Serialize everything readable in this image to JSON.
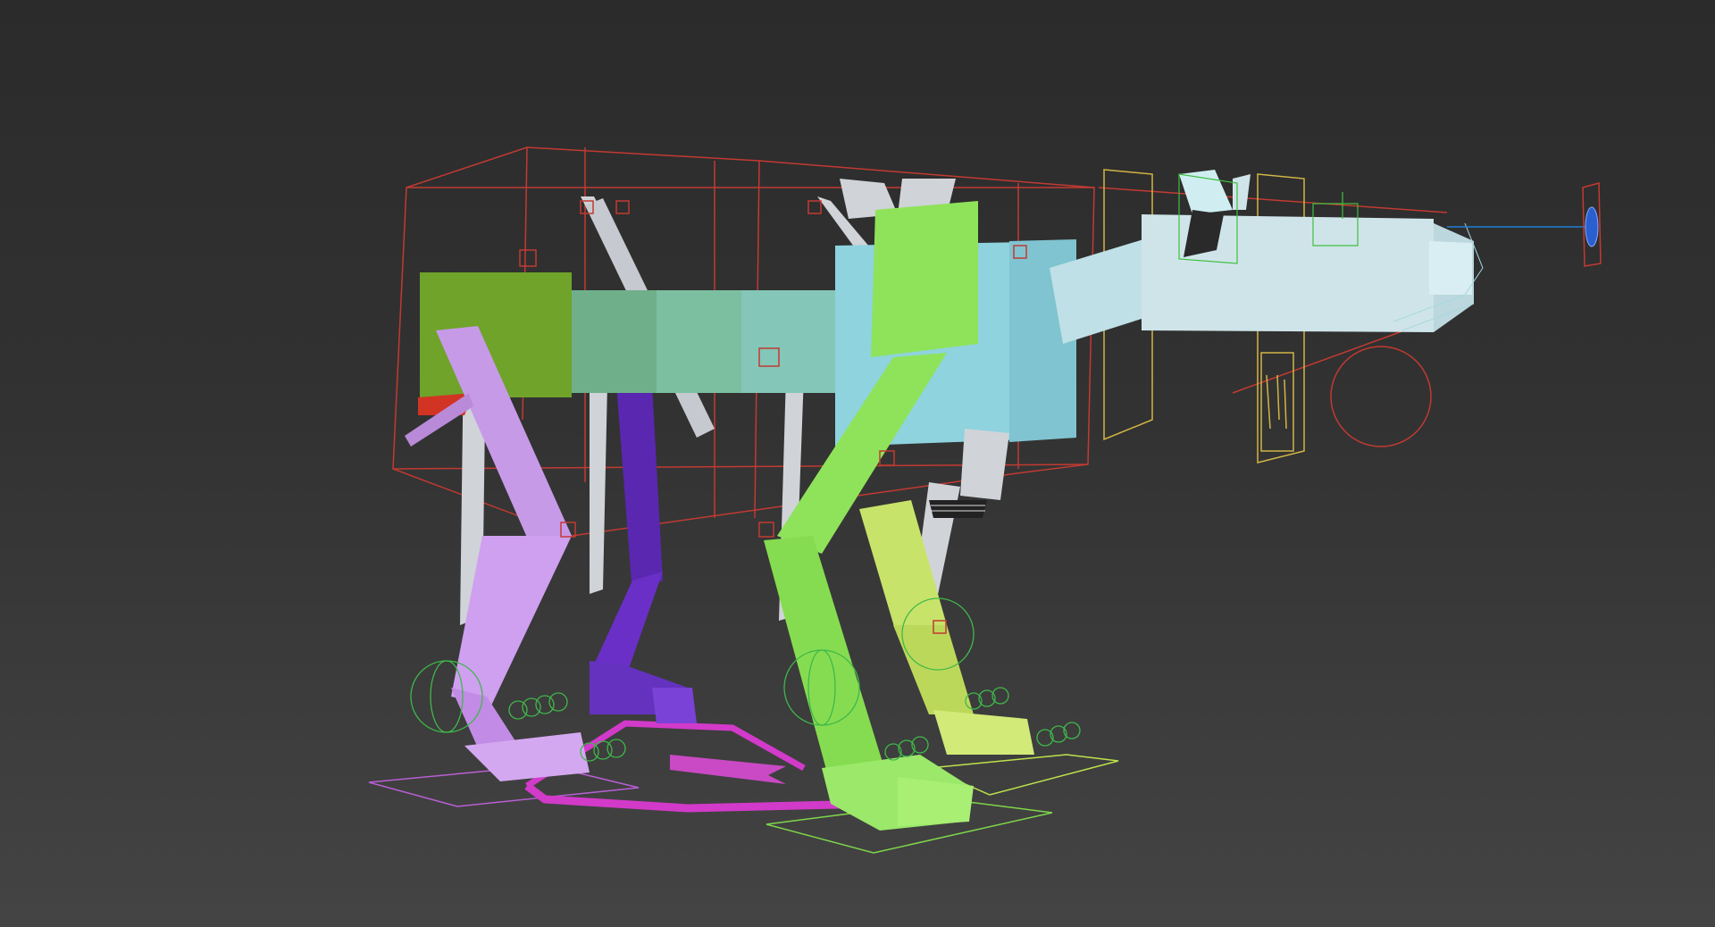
{
  "viewport": {
    "name": "perspective-viewport",
    "background_top": "#2b2b2b",
    "background_bottom": "#444444",
    "shading": "default-shading",
    "show_grid": false
  },
  "scene": {
    "subject": "quadruped-creature-rig",
    "colors": {
      "torso_rear": "#6fa32a",
      "torso_mid": "#7cc0a0",
      "torso_front": "#8ed3de",
      "head": "#cfe4e9",
      "spine_bones": "#d0d3d8",
      "leg_back_left": "#c79ae8",
      "leg_back_right": "#6a2fc6",
      "leg_front_left": "#8fe35a",
      "leg_front_right": "#c8e36a",
      "selection_box": "#c23a32",
      "ik_helper": "#3fbf3f",
      "spring_helper": "#3fb84a",
      "foot_plane": "#8f4fd1",
      "path_arrow": "#d23ac9",
      "look_target": "#1e7fd6",
      "head_frame": "#d2b545"
    }
  }
}
